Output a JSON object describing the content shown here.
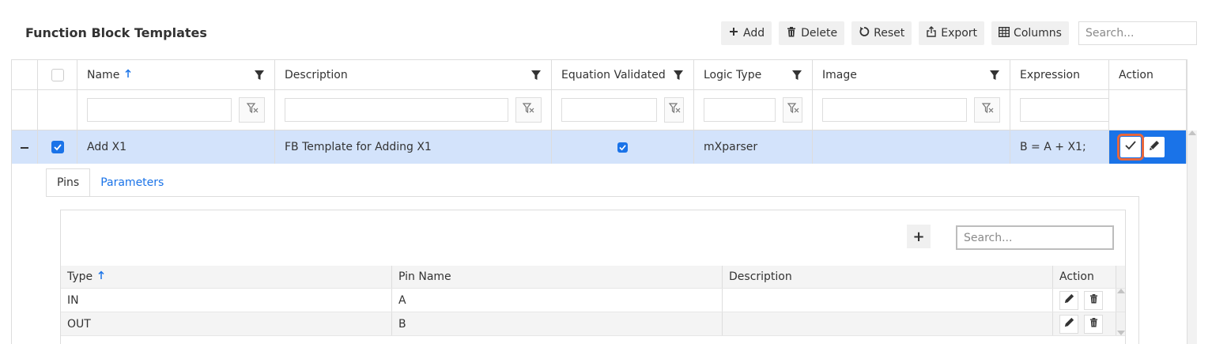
{
  "page": {
    "title": "Function Block Templates"
  },
  "toolbar": {
    "add_label": "Add",
    "delete_label": "Delete",
    "reset_label": "Reset",
    "export_label": "Export",
    "columns_label": "Columns",
    "search_placeholder": "Search..."
  },
  "grid": {
    "columns": [
      "Name",
      "Description",
      "Equation Validated",
      "Logic Type",
      "Image",
      "Expression",
      "Action"
    ],
    "sort_column": "Name",
    "rows": [
      {
        "name": "Add X1",
        "description": "FB Template for Adding X1",
        "equation_validated": true,
        "logic_type": "mXparser",
        "image": "",
        "expression": "B = A + X1;",
        "selected": true,
        "expanded": true
      }
    ]
  },
  "detail": {
    "tabs": [
      "Pins",
      "Parameters"
    ],
    "active_tab": "Pins",
    "search_placeholder": "Search...",
    "add_label": "+",
    "columns": [
      "Type",
      "Pin Name",
      "Description",
      "Action"
    ],
    "sort_column": "Type",
    "rows": [
      {
        "type": "IN",
        "pin_name": "A",
        "description": ""
      },
      {
        "type": "OUT",
        "pin_name": "B",
        "description": ""
      }
    ]
  },
  "colors": {
    "accent": "#1a73e8",
    "selected_row": "#d3e3fb",
    "highlight_outline": "#e8673c"
  }
}
